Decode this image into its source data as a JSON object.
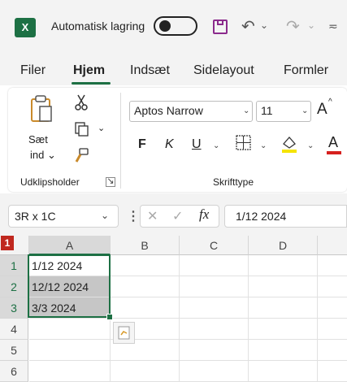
{
  "title_bar": {
    "app_icon_letter": "X",
    "autosave_label": "Automatisk lagring",
    "autosave_state": "off",
    "undo_glyph": "↶",
    "redo_glyph": "↷",
    "dropdown_glyph": "⌄",
    "more_glyph": "≂",
    "icons": [
      "excel-icon",
      "save-icon",
      "undo-icon",
      "redo-icon",
      "customize-qat-icon"
    ],
    "brand_color": "#1d7044",
    "save_color": "#8b2a8c"
  },
  "tabs": [
    {
      "label": "Filer",
      "active": false
    },
    {
      "label": "Hjem",
      "active": true
    },
    {
      "label": "Indsæt",
      "active": false
    },
    {
      "label": "Sidelayout",
      "active": false
    },
    {
      "label": "Formler",
      "active": false
    }
  ],
  "ribbon": {
    "clipboard": {
      "paste_label_1": "Sæt",
      "paste_label_2": "ind ⌄",
      "copy_dropdown": "⌄",
      "group_label": "Udklipsholder",
      "launcher_glyph": "↘"
    },
    "font": {
      "font_name": "Aptos Narrow",
      "font_size": "11",
      "grow_font_glyph": "A",
      "bold": "F",
      "italic": "K",
      "underline": "U",
      "fill_letter": "⌂",
      "font_color_letter": "A",
      "group_label": "Skrifttype",
      "fill_color": "#f5e400",
      "font_color": "#d6201e"
    }
  },
  "formula_bar": {
    "name_box": "3R x 1C",
    "fx_label": "fx",
    "cancel_glyph": "✕",
    "enter_glyph": "✓",
    "formula": "1/12 2024"
  },
  "grid": {
    "badge": "1",
    "columns": [
      "A",
      "B",
      "C",
      "D"
    ],
    "rows": [
      {
        "num": "1",
        "a": "1/12 2024"
      },
      {
        "num": "2",
        "a": "12/12 2024"
      },
      {
        "num": "3",
        "a": "3/3 2024"
      },
      {
        "num": "4",
        "a": ""
      },
      {
        "num": "5",
        "a": ""
      },
      {
        "num": "6",
        "a": ""
      }
    ],
    "selection_color": "#1d7044"
  }
}
